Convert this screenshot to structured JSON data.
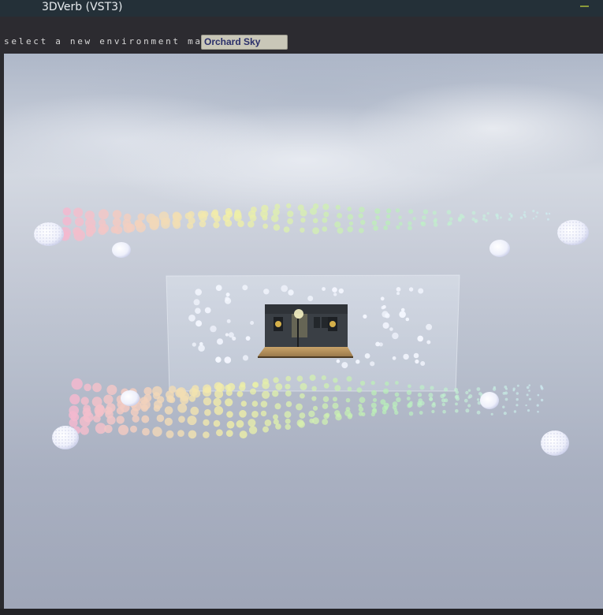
{
  "window": {
    "title": "3DVerb (VST3)",
    "minimize_icon": "minimize-icon"
  },
  "environment": {
    "label": "select a new environment map:",
    "selected": "Orchard Sky"
  },
  "scene": {
    "speaker_icon": "speaker-sphere-icon",
    "room_icon": "listening-room-icon",
    "colors": {
      "particle_pink": "#f3b9cf",
      "particle_yellow": "#f2f0a6",
      "particle_green": "#b9f0b8",
      "particle_cyan": "#cfeff4",
      "reflection_particle": "#f4f7ff",
      "speaker_sphere": "#f2f3fb"
    }
  }
}
